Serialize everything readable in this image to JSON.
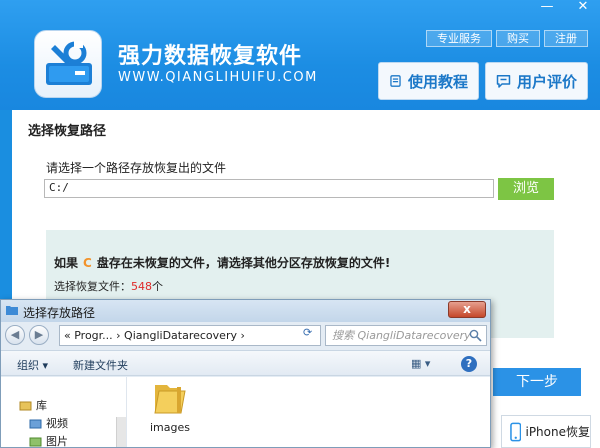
{
  "window": {
    "minimize": "—",
    "close": "✕"
  },
  "header": {
    "title": "强力数据恢复软件",
    "url": "WWW.QIANGLIHUIFU.COM",
    "links": [
      "专业服务",
      "购买",
      "注册"
    ],
    "tutorial_label": "使用教程",
    "review_label": "用户评价"
  },
  "main": {
    "section_title": "选择恢复路径",
    "path_label": "请选择一个路径存放恢复出的文件",
    "path_value": "C:/",
    "browse_label": "浏览",
    "warning_prefix": "如果",
    "warning_drive": "C",
    "warning_suffix": "盘存在未恢复的文件，请选择其他分区存放恢复的文件!",
    "count_prefix": "选择恢复文件：",
    "count_value": "548",
    "count_suffix": "个",
    "next_label": "下一步",
    "iphone_label": "iPhone恢复"
  },
  "dialog": {
    "title": "选择存放路径",
    "close": "x",
    "address": "« Progr... › QiangliDatarecovery ›",
    "search_placeholder": "搜索 QiangliDatarecovery",
    "organize_label": "组织 ▾",
    "new_folder_label": "新建文件夹",
    "view_label": "▦ ▾",
    "help_label": "?",
    "nav_items": [
      "库",
      "视频",
      "图片"
    ],
    "file_name": "images"
  },
  "colors": {
    "accent": "#1c8de3",
    "browse": "#7dc544",
    "next": "#2b92e6",
    "warning_drive": "#f2932b",
    "count": "#e02a2a"
  }
}
